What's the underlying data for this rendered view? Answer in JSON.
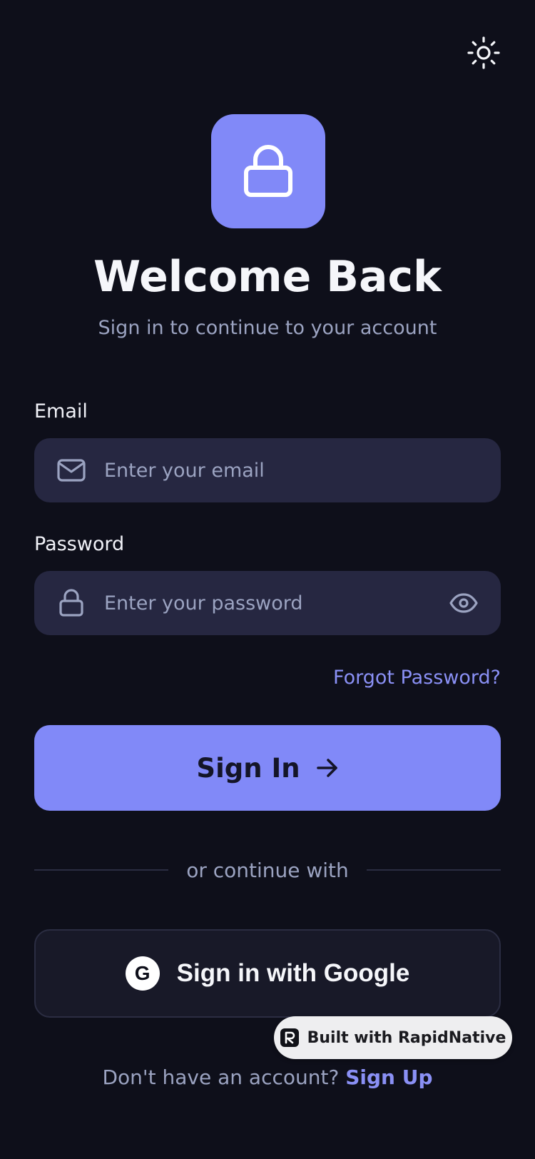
{
  "header": {
    "theme_icon": "sun-icon"
  },
  "hero": {
    "logo_icon": "lock-icon",
    "title": "Welcome Back",
    "subtitle": "Sign in to continue to your account"
  },
  "form": {
    "email": {
      "label": "Email",
      "placeholder": "Enter your email",
      "value": "",
      "icon": "mail-icon"
    },
    "password": {
      "label": "Password",
      "placeholder": "Enter your password",
      "value": "",
      "icon": "lock-icon",
      "toggle_icon": "eye-icon"
    },
    "forgot_label": "Forgot Password?",
    "submit_label": "Sign In"
  },
  "divider": {
    "label": "or continue with"
  },
  "social": {
    "google_mark": "G",
    "google_label": "Sign in with Google"
  },
  "badge": {
    "label": "Built with RapidNative"
  },
  "footer": {
    "prompt": "Don't have an account?",
    "link": "Sign Up"
  },
  "colors": {
    "background": "#0e0f1a",
    "accent": "#8189f8",
    "input_bg": "#262741",
    "muted_text": "#9ba3c1",
    "link": "#8a90f5"
  }
}
